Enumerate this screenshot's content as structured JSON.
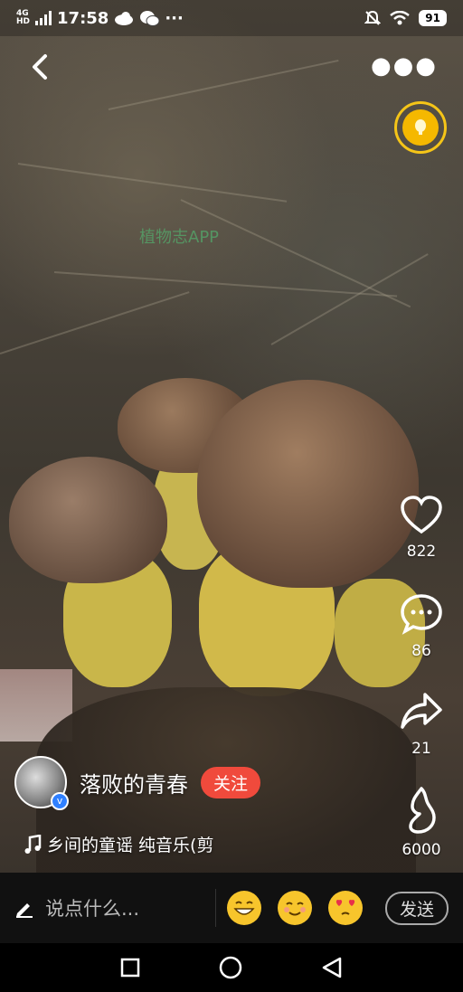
{
  "status": {
    "network": "4G",
    "network_sub": "HD",
    "time": "17:58",
    "battery": "91"
  },
  "watermark": "植物志APP",
  "actions": {
    "like_count": "822",
    "comment_count": "86",
    "share_count": "21",
    "gift_count": "6000"
  },
  "author": {
    "name": "落败的青春",
    "follow_label": "关注"
  },
  "music": {
    "title": "乡间的童谣 纯音乐(剪"
  },
  "comment_bar": {
    "placeholder": "说点什么...",
    "send_label": "发送"
  },
  "colors": {
    "follow": "#f04a3c",
    "coin": "#f5b800",
    "verify": "#2f80ff"
  },
  "icons": {
    "back": "back-arrow-icon",
    "more": "more-dots-icon",
    "coin": "gold-coin-icon",
    "like": "heart-icon",
    "comment": "comment-bubble-icon",
    "share": "share-arrow-icon",
    "gift": "flame-icon",
    "music": "music-note-icon",
    "edit": "pencil-icon"
  }
}
